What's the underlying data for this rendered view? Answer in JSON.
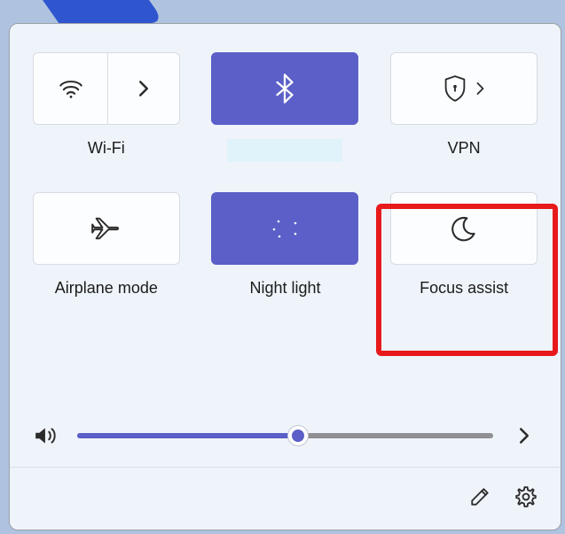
{
  "accent": "#5b5fc7",
  "highlight_target": "focus-assist",
  "tiles": {
    "wifi": {
      "label": "Wi-Fi",
      "active": false,
      "has_chevron": true
    },
    "bluetooth": {
      "label": "",
      "active": true
    },
    "vpn": {
      "label": "VPN",
      "active": false,
      "has_chevron_inline": true
    },
    "airplane": {
      "label": "Airplane mode",
      "active": false
    },
    "nightlight": {
      "label": "Night light",
      "active": true
    },
    "focusassist": {
      "label": "Focus assist",
      "active": false
    }
  },
  "volume": {
    "percent": 53
  },
  "footer": {
    "edit_label": "Edit quick settings",
    "settings_label": "Settings"
  }
}
